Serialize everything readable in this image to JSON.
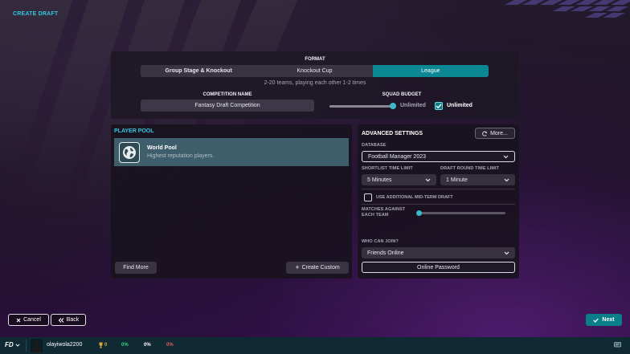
{
  "header": {
    "title": "CREATE DRAFT"
  },
  "format": {
    "label": "FORMAT",
    "tabs": [
      {
        "label": "Group Stage & Knockout",
        "active": false
      },
      {
        "label": "Knockout Cup",
        "active": false
      },
      {
        "label": "League",
        "active": true
      }
    ],
    "description": "2-20 teams, playing each other 1-2 times"
  },
  "competition": {
    "label": "COMPETITION NAME",
    "value": "Fantasy Draft Competition"
  },
  "budget": {
    "label": "SQUAD BUDGET",
    "slider_value": "Unlimited",
    "slider_fraction": 1.0,
    "checkbox_label": "Unlimited",
    "checked": true
  },
  "player_pool": {
    "title": "PLAYER POOL",
    "items": [
      {
        "name": "World Pool",
        "description": "Highest reputation players.",
        "icon": "globe-icon"
      }
    ],
    "find_more": "Find More",
    "create_custom": "Create Custom"
  },
  "advanced": {
    "title": "ADVANCED SETTINGS",
    "more_button": "More...",
    "database_label": "DATABASE",
    "database_value": "Football Manager 2023",
    "shortlist_label": "SHORTLIST TIME LIMIT",
    "shortlist_value": "5 Minutes",
    "draft_round_label": "DRAFT ROUND TIME LIMIT",
    "draft_round_value": "1 Minute",
    "midterm_label": "USE ADDITIONAL MID-TERM DRAFT",
    "midterm_checked": false,
    "matches_label_1": "MATCHES AGAINST",
    "matches_label_2": "EACH TEAM",
    "matches_fraction": 0.0,
    "who_can_join_label": "WHO CAN JOIN?",
    "who_can_join_value": "Friends Online",
    "online_password": "Online Password"
  },
  "nav": {
    "cancel": "Cancel",
    "back": "Back",
    "next": "Next"
  },
  "status_bar": {
    "logo": "FD",
    "username": "olayiwola2200",
    "trophies": "0",
    "stat_green": "0%",
    "stat_white": "0%",
    "stat_red": "0%"
  },
  "colors": {
    "accent": "#0b8893",
    "title_cyan": "#35c8e0",
    "stat_green": "#3ad47a",
    "stat_red": "#e05a5a",
    "trophy_gold": "#d4a73a"
  }
}
